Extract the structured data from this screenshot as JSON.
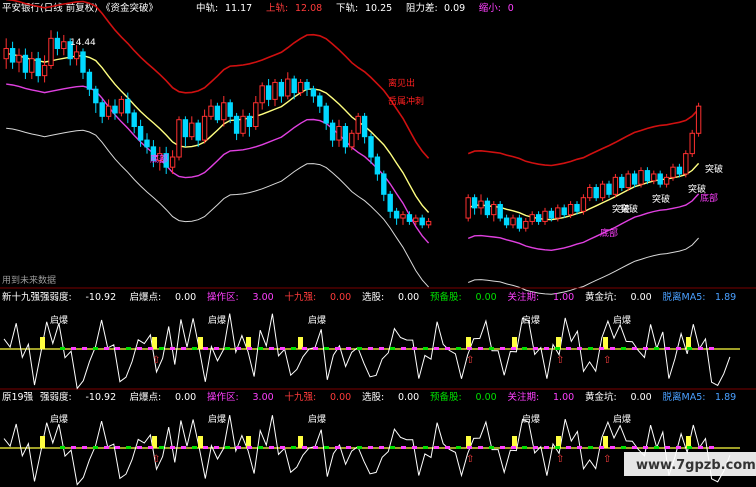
{
  "header": {
    "title": "平安银行(日线 前复权) 《资金突破》",
    "items": [
      {
        "label": "中轨:",
        "value": "11.17",
        "color": "#ffffff"
      },
      {
        "label": "上轨:",
        "value": "12.08",
        "color": "#ff3b3b"
      },
      {
        "label": "下轨:",
        "value": "10.25",
        "color": "#ffffff"
      },
      {
        "label": "阻力差:",
        "value": "0.09",
        "color": "#ffffff"
      },
      {
        "label": "缩小:",
        "value": "0",
        "color": "#ff40ff"
      }
    ]
  },
  "main_chart": {
    "price_label": "14.44",
    "annotations": [
      "底部",
      "突破",
      "突破",
      "突破",
      "突破",
      "突破",
      "底部",
      "底部",
      "离见出",
      "岳属冲刺"
    ],
    "bottom_text": "用到未来数据"
  },
  "panel1": {
    "title": "新十九强",
    "items": [
      {
        "label": "强弱度:",
        "value": "-10.92",
        "color": "#ffffff"
      },
      {
        "label": "启爆点:",
        "value": "0.00",
        "color": "#ffffff"
      },
      {
        "label": "操作区:",
        "value": "3.00",
        "color": "#ff40ff"
      },
      {
        "label": "十九强:",
        "value": "0.00",
        "color": "#ff3b3b"
      },
      {
        "label": "选股:",
        "value": "0.00",
        "color": "#ffffff"
      },
      {
        "label": "预备股:",
        "value": "0.00",
        "color": "#00e000"
      },
      {
        "label": "关注期:",
        "value": "1.00",
        "color": "#ff40ff"
      },
      {
        "label": "黄金坑:",
        "value": "0.00",
        "color": "#ffffff"
      },
      {
        "label": "脱离MA5:",
        "value": "1.89",
        "color": "#4aa0ff"
      }
    ],
    "annotation": "启爆"
  },
  "panel2": {
    "title": "原19强",
    "items": [
      {
        "label": "强弱度:",
        "value": "-10.92",
        "color": "#ffffff"
      },
      {
        "label": "启爆点:",
        "value": "0.00",
        "color": "#ffffff"
      },
      {
        "label": "操作区:",
        "value": "3.00",
        "color": "#ff40ff"
      },
      {
        "label": "十九强:",
        "value": "0.00",
        "color": "#ff3b3b"
      },
      {
        "label": "选股:",
        "value": "0.00",
        "color": "#ffffff"
      },
      {
        "label": "预备股:",
        "value": "0.00",
        "color": "#00e000"
      },
      {
        "label": "关注期:",
        "value": "1.00",
        "color": "#ff40ff"
      },
      {
        "label": "黄金坑:",
        "value": "0.00",
        "color": "#ffffff"
      },
      {
        "label": "脱离MA5:",
        "value": "1.89",
        "color": "#4aa0ff"
      }
    ],
    "annotation": "启爆"
  },
  "watermark": "www.7gpzb.com",
  "chart_data": {
    "type": "candlestick",
    "bands": {
      "mid": 11.17,
      "upper": 12.08,
      "lower": 10.25
    },
    "ylim": [
      8.4,
      14.8
    ],
    "candles": [
      {
        "o": 13.6,
        "c": 13.9,
        "h": 14.2,
        "l": 13.3
      },
      {
        "o": 13.9,
        "c": 13.5,
        "h": 14.1,
        "l": 13.3
      },
      {
        "o": 13.5,
        "c": 13.7,
        "h": 13.9,
        "l": 13.2
      },
      {
        "o": 13.7,
        "c": 13.2,
        "h": 13.9,
        "l": 13.0
      },
      {
        "o": 13.2,
        "c": 13.6,
        "h": 13.8,
        "l": 13.0
      },
      {
        "o": 13.6,
        "c": 13.1,
        "h": 13.8,
        "l": 12.9
      },
      {
        "o": 13.1,
        "c": 13.4,
        "h": 13.7,
        "l": 12.9
      },
      {
        "o": 13.4,
        "c": 14.2,
        "h": 14.44,
        "l": 13.3
      },
      {
        "o": 14.2,
        "c": 13.9,
        "h": 14.4,
        "l": 13.7
      },
      {
        "o": 13.9,
        "c": 14.1,
        "h": 14.3,
        "l": 13.7
      },
      {
        "o": 14.1,
        "c": 13.6,
        "h": 14.2,
        "l": 13.4
      },
      {
        "o": 13.6,
        "c": 13.8,
        "h": 14.0,
        "l": 13.4
      },
      {
        "o": 13.8,
        "c": 13.2,
        "h": 13.9,
        "l": 13.0
      },
      {
        "o": 13.2,
        "c": 12.7,
        "h": 13.3,
        "l": 12.5
      },
      {
        "o": 12.7,
        "c": 12.3,
        "h": 12.8,
        "l": 12.0
      },
      {
        "o": 12.3,
        "c": 11.9,
        "h": 12.4,
        "l": 11.7
      },
      {
        "o": 11.9,
        "c": 12.2,
        "h": 12.4,
        "l": 11.8
      },
      {
        "o": 12.2,
        "c": 12.0,
        "h": 12.4,
        "l": 11.8
      },
      {
        "o": 12.0,
        "c": 12.4,
        "h": 12.5,
        "l": 11.9
      },
      {
        "o": 12.4,
        "c": 12.0,
        "h": 12.6,
        "l": 11.7
      },
      {
        "o": 12.0,
        "c": 11.6,
        "h": 12.1,
        "l": 11.4
      },
      {
        "o": 11.6,
        "c": 11.2,
        "h": 11.8,
        "l": 11.0
      },
      {
        "o": 11.2,
        "c": 11.0,
        "h": 11.4,
        "l": 10.8
      },
      {
        "o": 11.0,
        "c": 10.6,
        "h": 11.2,
        "l": 10.4
      },
      {
        "o": 10.6,
        "c": 10.8,
        "h": 11.0,
        "l": 10.3
      },
      {
        "o": 10.8,
        "c": 10.4,
        "h": 11.0,
        "l": 10.2
      },
      {
        "o": 10.4,
        "c": 10.7,
        "h": 10.9,
        "l": 10.2
      },
      {
        "o": 10.7,
        "c": 11.8,
        "h": 11.9,
        "l": 10.6
      },
      {
        "o": 11.8,
        "c": 11.3,
        "h": 11.9,
        "l": 11.0
      },
      {
        "o": 11.3,
        "c": 11.7,
        "h": 11.9,
        "l": 11.2
      },
      {
        "o": 11.7,
        "c": 11.2,
        "h": 11.8,
        "l": 11.0
      },
      {
        "o": 11.2,
        "c": 11.9,
        "h": 12.1,
        "l": 11.1
      },
      {
        "o": 11.9,
        "c": 12.2,
        "h": 12.4,
        "l": 11.8
      },
      {
        "o": 12.2,
        "c": 11.8,
        "h": 12.3,
        "l": 11.7
      },
      {
        "o": 11.8,
        "c": 12.3,
        "h": 12.5,
        "l": 11.6
      },
      {
        "o": 12.3,
        "c": 11.9,
        "h": 12.4,
        "l": 11.7
      },
      {
        "o": 11.9,
        "c": 11.4,
        "h": 12.0,
        "l": 11.2
      },
      {
        "o": 11.4,
        "c": 11.9,
        "h": 12.1,
        "l": 11.3
      },
      {
        "o": 11.9,
        "c": 11.6,
        "h": 12.0,
        "l": 11.3
      },
      {
        "o": 11.6,
        "c": 12.3,
        "h": 12.5,
        "l": 11.5
      },
      {
        "o": 12.3,
        "c": 12.8,
        "h": 12.9,
        "l": 12.1
      },
      {
        "o": 12.8,
        "c": 12.4,
        "h": 13.0,
        "l": 12.2
      },
      {
        "o": 12.4,
        "c": 12.9,
        "h": 13.0,
        "l": 12.2
      },
      {
        "o": 12.9,
        "c": 12.5,
        "h": 13.0,
        "l": 12.3
      },
      {
        "o": 12.5,
        "c": 13.0,
        "h": 13.2,
        "l": 12.4
      },
      {
        "o": 13.0,
        "c": 12.6,
        "h": 13.1,
        "l": 12.4
      },
      {
        "o": 12.6,
        "c": 12.9,
        "h": 13.0,
        "l": 12.5
      },
      {
        "o": 12.9,
        "c": 12.7,
        "h": 13.0,
        "l": 12.5
      },
      {
        "o": 12.7,
        "c": 12.5,
        "h": 12.8,
        "l": 12.3
      },
      {
        "o": 12.5,
        "c": 12.2,
        "h": 12.6,
        "l": 12.0
      },
      {
        "o": 12.2,
        "c": 11.7,
        "h": 12.3,
        "l": 11.5
      },
      {
        "o": 11.7,
        "c": 11.2,
        "h": 11.8,
        "l": 11.0
      },
      {
        "o": 11.2,
        "c": 11.6,
        "h": 11.8,
        "l": 11.0
      },
      {
        "o": 11.6,
        "c": 11.0,
        "h": 11.7,
        "l": 10.8
      },
      {
        "o": 11.0,
        "c": 11.4,
        "h": 11.5,
        "l": 10.9
      },
      {
        "o": 11.4,
        "c": 11.9,
        "h": 12.0,
        "l": 11.2
      },
      {
        "o": 11.9,
        "c": 11.3,
        "h": 12.0,
        "l": 11.1
      },
      {
        "o": 11.3,
        "c": 10.7,
        "h": 11.4,
        "l": 10.5
      },
      {
        "o": 10.7,
        "c": 10.2,
        "h": 10.8,
        "l": 10.0
      },
      {
        "o": 10.2,
        "c": 9.6,
        "h": 10.3,
        "l": 9.4
      },
      {
        "o": 9.6,
        "c": 9.1,
        "h": 9.7,
        "l": 8.9
      },
      {
        "o": 9.1,
        "c": 8.9,
        "h": 9.2,
        "l": 8.7
      },
      {
        "o": 8.9,
        "c": 9.0,
        "h": 9.1,
        "l": 8.7
      },
      {
        "o": 9.0,
        "c": 8.8,
        "h": 9.1,
        "l": 8.7
      },
      {
        "o": 8.8,
        "c": 8.9,
        "h": 9.0,
        "l": 8.7
      },
      {
        "o": 8.9,
        "c": 8.7,
        "h": 9.0,
        "l": 8.6
      },
      {
        "o": 8.7,
        "c": 8.8,
        "h": 8.9,
        "l": 8.6
      }
    ],
    "candles2": [
      {
        "o": 8.9,
        "c": 9.5,
        "h": 9.6,
        "l": 8.8
      },
      {
        "o": 9.5,
        "c": 9.2,
        "h": 9.6,
        "l": 9.0
      },
      {
        "o": 9.2,
        "c": 9.4,
        "h": 9.6,
        "l": 9.0
      },
      {
        "o": 9.4,
        "c": 9.0,
        "h": 9.5,
        "l": 8.9
      },
      {
        "o": 9.0,
        "c": 9.3,
        "h": 9.4,
        "l": 8.8
      },
      {
        "o": 9.3,
        "c": 8.9,
        "h": 9.4,
        "l": 8.8
      },
      {
        "o": 8.9,
        "c": 8.7,
        "h": 9.0,
        "l": 8.6
      },
      {
        "o": 8.7,
        "c": 8.9,
        "h": 9.0,
        "l": 8.6
      },
      {
        "o": 8.9,
        "c": 8.6,
        "h": 9.0,
        "l": 8.5
      },
      {
        "o": 8.6,
        "c": 8.8,
        "h": 8.9,
        "l": 8.5
      },
      {
        "o": 8.8,
        "c": 9.0,
        "h": 9.1,
        "l": 8.7
      },
      {
        "o": 9.0,
        "c": 8.8,
        "h": 9.1,
        "l": 8.7
      },
      {
        "o": 8.8,
        "c": 9.1,
        "h": 9.2,
        "l": 8.7
      },
      {
        "o": 9.1,
        "c": 8.9,
        "h": 9.2,
        "l": 8.8
      },
      {
        "o": 8.9,
        "c": 9.2,
        "h": 9.3,
        "l": 8.8
      },
      {
        "o": 9.2,
        "c": 9.0,
        "h": 9.3,
        "l": 8.9
      },
      {
        "o": 9.0,
        "c": 9.3,
        "h": 9.4,
        "l": 8.9
      },
      {
        "o": 9.3,
        "c": 9.1,
        "h": 9.4,
        "l": 9.0
      },
      {
        "o": 9.1,
        "c": 9.5,
        "h": 9.6,
        "l": 9.0
      },
      {
        "o": 9.5,
        "c": 9.8,
        "h": 9.9,
        "l": 9.4
      },
      {
        "o": 9.8,
        "c": 9.5,
        "h": 9.9,
        "l": 9.4
      },
      {
        "o": 9.5,
        "c": 9.9,
        "h": 10.0,
        "l": 9.4
      },
      {
        "o": 9.9,
        "c": 9.6,
        "h": 10.0,
        "l": 9.5
      },
      {
        "o": 9.6,
        "c": 10.1,
        "h": 10.2,
        "l": 9.5
      },
      {
        "o": 10.1,
        "c": 9.8,
        "h": 10.2,
        "l": 9.7
      },
      {
        "o": 9.8,
        "c": 10.2,
        "h": 10.3,
        "l": 9.7
      },
      {
        "o": 10.2,
        "c": 9.9,
        "h": 10.3,
        "l": 9.8
      },
      {
        "o": 9.9,
        "c": 10.3,
        "h": 10.4,
        "l": 9.8
      },
      {
        "o": 10.3,
        "c": 10.0,
        "h": 10.4,
        "l": 9.9
      },
      {
        "o": 10.0,
        "c": 10.2,
        "h": 10.3,
        "l": 9.9
      },
      {
        "o": 10.2,
        "c": 9.9,
        "h": 10.3,
        "l": 9.8
      },
      {
        "o": 9.9,
        "c": 10.1,
        "h": 10.2,
        "l": 9.8
      },
      {
        "o": 10.1,
        "c": 10.4,
        "h": 10.5,
        "l": 10.0
      },
      {
        "o": 10.4,
        "c": 10.2,
        "h": 10.5,
        "l": 10.1
      },
      {
        "o": 10.2,
        "c": 10.8,
        "h": 10.9,
        "l": 10.1
      },
      {
        "o": 10.8,
        "c": 11.4,
        "h": 11.5,
        "l": 10.7
      },
      {
        "o": 11.4,
        "c": 12.2,
        "h": 12.3,
        "l": 11.3
      }
    ]
  }
}
